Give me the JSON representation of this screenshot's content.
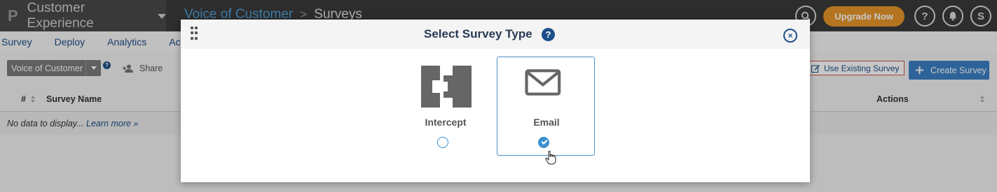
{
  "app": {
    "logo": "P",
    "product": "Customer Experience"
  },
  "breadcrumb": {
    "parent": "Voice of Customer",
    "separator": ">",
    "current": "Surveys"
  },
  "header_actions": {
    "upgrade_label": "Upgrade Now",
    "help_label": "?",
    "user_initial": "S"
  },
  "nav": {
    "items": [
      "Survey",
      "Deploy",
      "Analytics",
      "Acti"
    ]
  },
  "toolbar": {
    "project_select": "Voice of Customer",
    "help_label": "?",
    "share_label": "Share",
    "use_existing_label": "Use Existing Survey",
    "create_label": "Create Survey"
  },
  "table": {
    "columns": [
      "#",
      "Survey Name",
      "Actions"
    ],
    "empty_text": "No data to display...",
    "learn_more": "Learn more »"
  },
  "modal": {
    "title": "Select Survey Type",
    "help_label": "?",
    "close_label": "×",
    "options": [
      {
        "label": "Intercept",
        "icon": "intercept-icon",
        "selected": false
      },
      {
        "label": "Email",
        "icon": "envelope-icon",
        "selected": true
      }
    ]
  },
  "colors": {
    "topbar": "#3a3a3a",
    "accent_blue": "#1d4f8a",
    "link_blue": "#4f9fd4",
    "upgrade_orange": "#e8962a",
    "radio_blue": "#3b8fd0"
  }
}
